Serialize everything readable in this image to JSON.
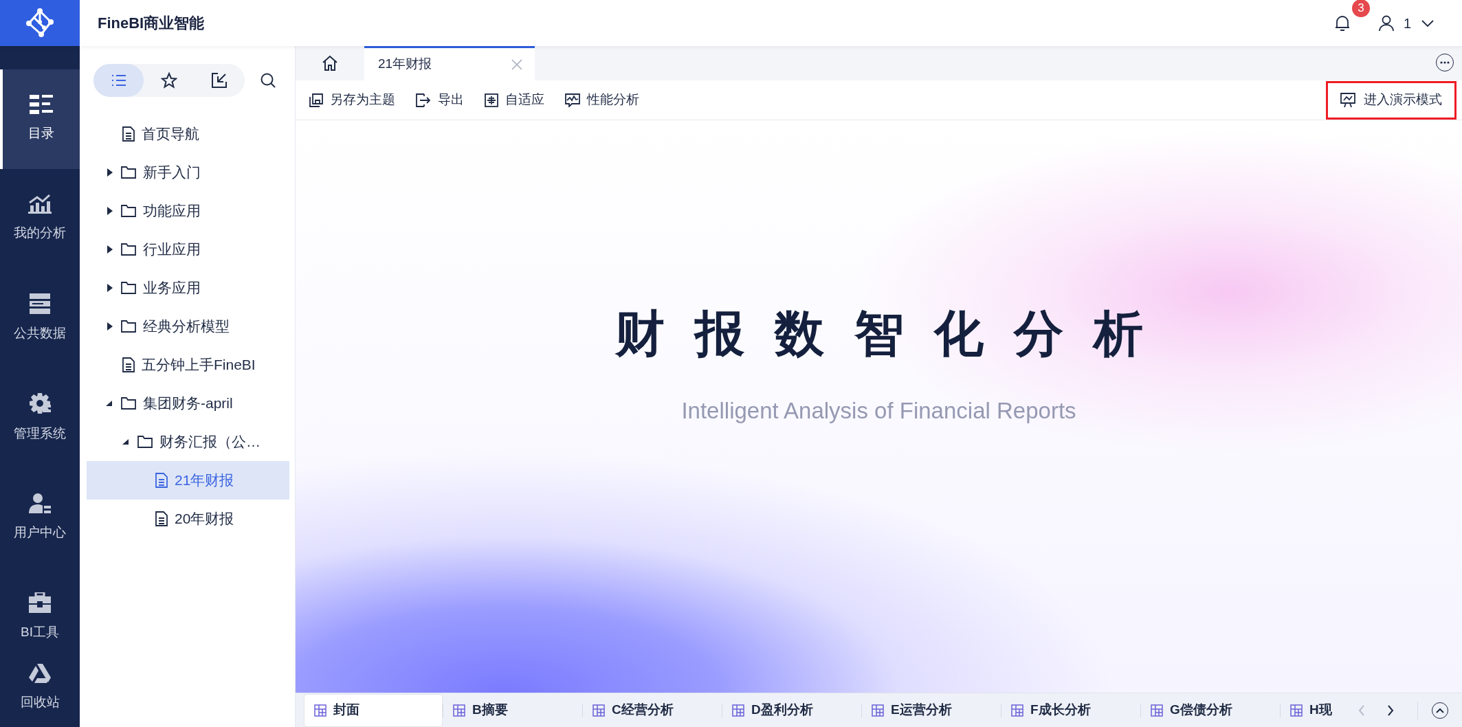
{
  "app": {
    "title": "FineBI商业智能",
    "notifications": "3",
    "user": "1"
  },
  "nav": [
    {
      "label": "目录",
      "selected": true
    },
    {
      "label": "我的分析",
      "selected": false
    },
    {
      "label": "公共数据",
      "selected": false
    },
    {
      "label": "管理系统",
      "selected": false
    },
    {
      "label": "用户中心",
      "selected": false
    },
    {
      "label": "BI工具",
      "selected": false
    },
    {
      "label": "回收站",
      "selected": false
    }
  ],
  "sidebar": {
    "view_tabs": [
      {
        "selected": true
      },
      {
        "selected": false
      },
      {
        "selected": false
      }
    ],
    "tree": [
      {
        "kind": "file",
        "label": "首页导航",
        "selected": false
      },
      {
        "kind": "folder",
        "label": "新手入门",
        "expanded": false,
        "selected": false
      },
      {
        "kind": "folder",
        "label": "功能应用",
        "expanded": false,
        "selected": false
      },
      {
        "kind": "folder",
        "label": "行业应用",
        "expanded": false,
        "selected": false
      },
      {
        "kind": "folder",
        "label": "业务应用",
        "expanded": false,
        "selected": false
      },
      {
        "kind": "folder",
        "label": "经典分析模型",
        "expanded": false,
        "selected": false
      },
      {
        "kind": "file",
        "label": "五分钟上手FineBI",
        "selected": false
      },
      {
        "kind": "folder",
        "label": "集团财务-april",
        "expanded": true,
        "selected": false,
        "children": [
          {
            "kind": "folder",
            "label": "财务汇报（公…",
            "expanded": true,
            "selected": false,
            "children": [
              {
                "kind": "file",
                "label": "21年财报",
                "selected": true
              },
              {
                "kind": "file",
                "label": "20年财报",
                "selected": false
              }
            ]
          }
        ]
      }
    ]
  },
  "doc_tabs": [
    {
      "label": "21年财报",
      "selected": true
    }
  ],
  "toolbar": [
    {
      "label": "另存为主题"
    },
    {
      "label": "导出"
    },
    {
      "label": "自适应"
    },
    {
      "label": "性能分析"
    }
  ],
  "present_button": {
    "label": "进入演示模式",
    "highlighted": true
  },
  "cover": {
    "title": "财报数智化分析",
    "subtitle": "Intelligent Analysis of Financial Reports"
  },
  "sheet_tabs": [
    {
      "label": "封面",
      "selected": true
    },
    {
      "label": "B摘要",
      "selected": false
    },
    {
      "label": "C经营分析",
      "selected": false
    },
    {
      "label": "D盈利分析",
      "selected": false
    },
    {
      "label": "E运营分析",
      "selected": false
    },
    {
      "label": "F成长分析",
      "selected": false
    },
    {
      "label": "G偿债分析",
      "selected": false
    },
    {
      "label": "H现",
      "selected": false
    }
  ]
}
